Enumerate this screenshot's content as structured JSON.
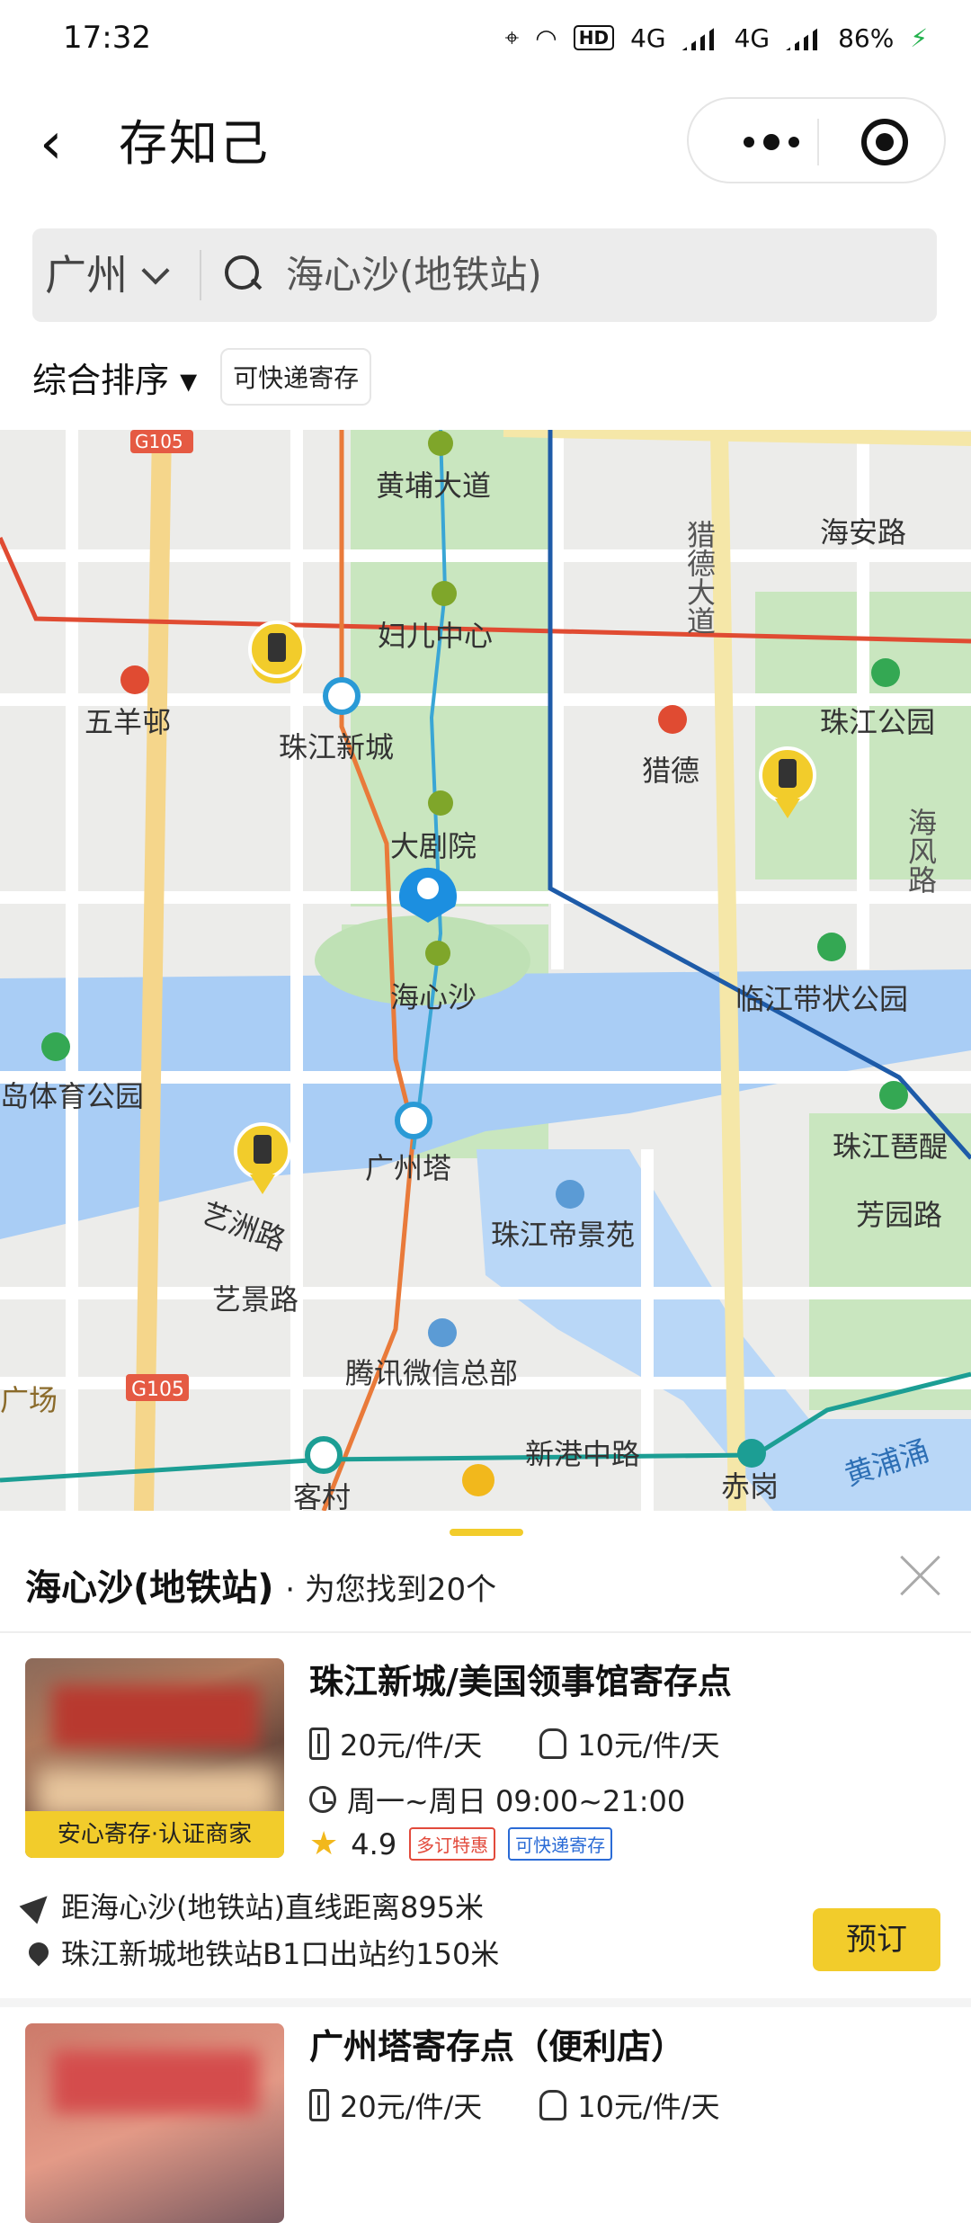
{
  "status_bar": {
    "time": "17:32",
    "hd": "HD",
    "net1": "4G",
    "net2": "4G",
    "battery": "86%"
  },
  "nav": {
    "title": "存知己"
  },
  "search": {
    "city": "广州",
    "query": "海心沙(地铁站)"
  },
  "filters": {
    "sort": "综合排序 ▾",
    "chip": "可快递寄存"
  },
  "map": {
    "labels": {
      "g105_top": "G105",
      "g105_bottom": "G105",
      "huangpu_dadao": "黄埔大道",
      "fuer_zhongxin": "妇儿中心",
      "wuyangyi": "五羊邨",
      "zhujiang_xincheng": "珠江新城",
      "liede": "猎德",
      "liede_dadao": "猎德大道",
      "haian_lu": "海安路",
      "zhujiang_gongyuan": "珠江公园",
      "haifeng_lu": "海风路",
      "dajuyuan": "大剧院",
      "haixinsha": "海心沙",
      "linjiang": "临江带状公园",
      "dao_tiyu": "岛体育公园",
      "guangzhou_ta": "广州塔",
      "zhujiang_pipa": "珠江琶醍",
      "fangyuan_lu": "芳园路",
      "yizhou_lu": "艺洲路",
      "yijing_lu": "艺景路",
      "diyingyuan": "珠江帝景苑",
      "tencent": "腾讯微信总部",
      "guangchang": "广场",
      "xingang_zhonglu": "新港中路",
      "kecun": "客村",
      "chigang": "赤岗",
      "huangpuyong": "黄浦涌"
    }
  },
  "sheet": {
    "title": "海心沙(地铁站)",
    "count": "· 为您找到20个",
    "cards": [
      {
        "name": "珠江新城/美国领事馆寄存点",
        "ribbon": "安心寄存·认证商家",
        "price_large": "20元/件/天",
        "price_small": "10元/件/天",
        "hours": "周一~周日 09:00~21:00",
        "rating": "4.9",
        "tag1": "多订特惠",
        "tag2": "可快递寄存",
        "distance": "距海心沙(地铁站)直线距离895米",
        "location": "珠江新城地铁站B1口出站约150米",
        "book": "预订"
      },
      {
        "name": "广州塔寄存点（便利店）",
        "price_large": "20元/件/天",
        "price_small": "10元/件/天"
      }
    ]
  },
  "colors": {
    "accent": "#f2cc2b",
    "river": "#a9cdf5",
    "park": "#c9e6bf",
    "metro_red": "#e04b32",
    "metro_blue": "#1e5ba8"
  }
}
